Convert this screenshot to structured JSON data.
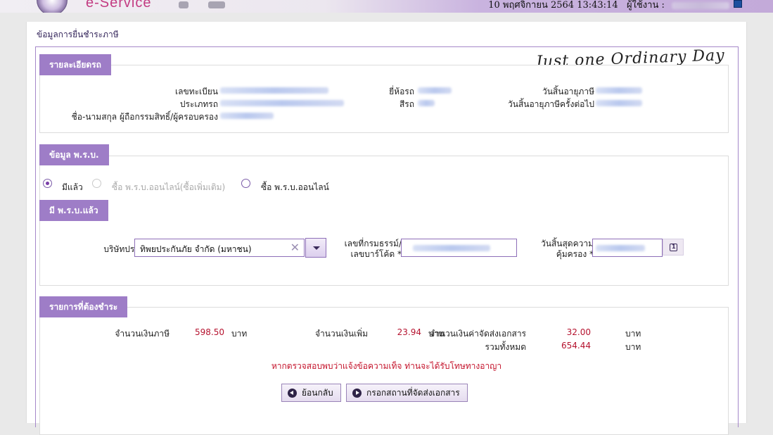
{
  "header": {
    "brand": "e-Service",
    "datetime": "10 พฤศจิกายน 2564 13:43:14",
    "user_label": "ผู้ใช้งาน :"
  },
  "breadcrumb": "ข้อมูลการยื่นชำระภาษี",
  "signature": "Just one Ordinary Day",
  "vehicle": {
    "title": "รายละเอียดรถ",
    "plate_label": "เลขทะเบียน",
    "type_label": "ประเภทรถ",
    "owner_label": "ชื่อ-นามสกุล ผู้ถือกรรมสิทธิ์/ผู้ครอบครอง",
    "brand_label": "ยี่ห้อรถ",
    "color_label": "สีรถ",
    "tax_expiry_label": "วันสิ้นอายุภาษี",
    "next_tax_expiry_label": "วันสิ้นอายุภาษีครั้งต่อไป"
  },
  "insurance": {
    "title": "ข้อมูล พ.ร.บ.",
    "options": [
      {
        "label": "มีแล้ว",
        "checked": true,
        "disabled": false
      },
      {
        "label": "ซื้อ พ.ร.บ.ออนไลน์(ซื้อเพิ่มเติม)",
        "checked": false,
        "disabled": true
      },
      {
        "label": "ซื้อ พ.ร.บ.ออนไลน์",
        "checked": false,
        "disabled": false
      }
    ],
    "has_title": "มี พ.ร.บ.แล้ว",
    "company_label": "บริษัทประกันภัย *",
    "company_value": "ทิพยประกันภัย จำกัด (มหาชน)",
    "policy_label_1": "เลขที่กรมธรรม์/",
    "policy_label_2": "เลขบาร์โค้ด *",
    "coverage_label_1": "วันสิ้นสุดความ",
    "coverage_label_2": "คุ้มครอง *"
  },
  "payment": {
    "title": "รายการที่ต้องชำระ",
    "tax_label": "จำนวนเงินภาษี",
    "tax_amount": "598.50",
    "surcharge_label": "จำนวนเงินเพิ่ม",
    "surcharge_amount": "23.94",
    "delivery_label": "จำนวนเงินค่าจัดส่งเอกสาร",
    "delivery_amount": "32.00",
    "total_label": "รวมทั้งหมด",
    "total_amount": "654.44",
    "currency": "บาท"
  },
  "warning": "หากตรวจสอบพบว่าแจ้งข้อความเท็จ ท่านจะได้รับโทษทางอาญา",
  "buttons": {
    "back": "ย้อนกลับ",
    "next": "กรอกสถานที่จัดส่งเอกสาร"
  }
}
